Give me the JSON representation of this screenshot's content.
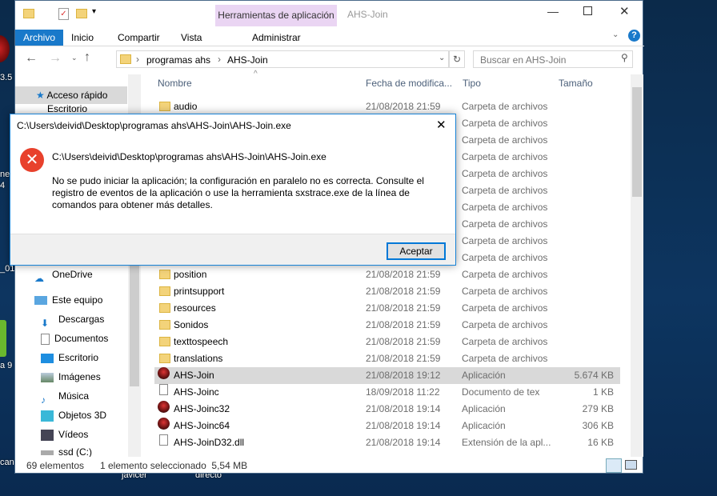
{
  "desktop": {
    "labels": [
      "3.5",
      "ne",
      "4",
      "_01",
      "a 9",
      "can",
      "javicer",
      "directo"
    ]
  },
  "window": {
    "context_tab": "Herramientas de aplicación",
    "title": "AHS-Join",
    "ribbon_tabs": [
      "Archivo",
      "Inicio",
      "Compartir",
      "Vista",
      "Administrar"
    ],
    "breadcrumb": [
      "programas ahs",
      "AHS-Join"
    ],
    "search_placeholder": "Buscar en AHS-Join",
    "columns": [
      "Nombre",
      "Fecha de modifica...",
      "Tipo",
      "Tamaño"
    ],
    "sidebar": {
      "quick": "Acceso rápido",
      "quick_sub": "Escritorio",
      "onedrive": "OneDrive",
      "pc": "Este equipo",
      "items": [
        "Descargas",
        "Documentos",
        "Escritorio",
        "Imágenes",
        "Música",
        "Objetos 3D",
        "Vídeos",
        "ssd (C:)"
      ]
    },
    "files": [
      {
        "name": "audio",
        "date": "21/08/2018 21:59",
        "type": "Carpeta de archivos",
        "size": "",
        "kind": "folder"
      },
      {
        "name": "",
        "date": "",
        "type": "Carpeta de archivos",
        "size": "",
        "kind": "folder"
      },
      {
        "name": "",
        "date": "",
        "type": "Carpeta de archivos",
        "size": "",
        "kind": "folder"
      },
      {
        "name": "",
        "date": "",
        "type": "Carpeta de archivos",
        "size": "",
        "kind": "folder"
      },
      {
        "name": "",
        "date": "",
        "type": "Carpeta de archivos",
        "size": "",
        "kind": "folder"
      },
      {
        "name": "",
        "date": "",
        "type": "Carpeta de archivos",
        "size": "",
        "kind": "folder"
      },
      {
        "name": "",
        "date": "",
        "type": "Carpeta de archivos",
        "size": "",
        "kind": "folder"
      },
      {
        "name": "",
        "date": "",
        "type": "Carpeta de archivos",
        "size": "",
        "kind": "folder"
      },
      {
        "name": "",
        "date": "",
        "type": "Carpeta de archivos",
        "size": "",
        "kind": "folder"
      },
      {
        "name": "",
        "date": "",
        "type": "Carpeta de archivos",
        "size": "",
        "kind": "folder"
      },
      {
        "name": "position",
        "date": "21/08/2018 21:59",
        "type": "Carpeta de archivos",
        "size": "",
        "kind": "folder"
      },
      {
        "name": "printsupport",
        "date": "21/08/2018 21:59",
        "type": "Carpeta de archivos",
        "size": "",
        "kind": "folder"
      },
      {
        "name": "resources",
        "date": "21/08/2018 21:59",
        "type": "Carpeta de archivos",
        "size": "",
        "kind": "folder"
      },
      {
        "name": "Sonidos",
        "date": "21/08/2018 21:59",
        "type": "Carpeta de archivos",
        "size": "",
        "kind": "folder"
      },
      {
        "name": "texttospeech",
        "date": "21/08/2018 21:59",
        "type": "Carpeta de archivos",
        "size": "",
        "kind": "folder"
      },
      {
        "name": "translations",
        "date": "21/08/2018 21:59",
        "type": "Carpeta de archivos",
        "size": "",
        "kind": "folder"
      },
      {
        "name": "AHS-Join",
        "date": "21/08/2018 19:12",
        "type": "Aplicación",
        "size": "5.674 KB",
        "kind": "app",
        "selected": true
      },
      {
        "name": "AHS-Joinc",
        "date": "18/09/2018 11:22",
        "type": "Documento de tex",
        "size": "1 KB",
        "kind": "doc"
      },
      {
        "name": "AHS-Joinc32",
        "date": "21/08/2018 19:14",
        "type": "Aplicación",
        "size": "279 KB",
        "kind": "app"
      },
      {
        "name": "AHS-Joinc64",
        "date": "21/08/2018 19:14",
        "type": "Aplicación",
        "size": "306 KB",
        "kind": "app"
      },
      {
        "name": "AHS-JoinD32.dll",
        "date": "21/08/2018 19:14",
        "type": "Extensión de la apl...",
        "size": "16 KB",
        "kind": "doc"
      }
    ],
    "status": {
      "count": "69 elementos",
      "selection": "1 elemento seleccionado  5,54 MB"
    }
  },
  "dialog": {
    "title": "C:\\Users\\deivid\\Desktop\\programas ahs\\AHS-Join\\AHS-Join.exe",
    "path": "C:\\Users\\deivid\\Desktop\\programas ahs\\AHS-Join\\AHS-Join.exe",
    "message": "No se pudo iniciar la aplicación; la configuración en paralelo no es correcta. Consulte el registro de eventos de la aplicación o use la herramienta sxstrace.exe de la línea de comandos para obtener más detalles.",
    "ok": "Aceptar",
    "close": "✕"
  }
}
